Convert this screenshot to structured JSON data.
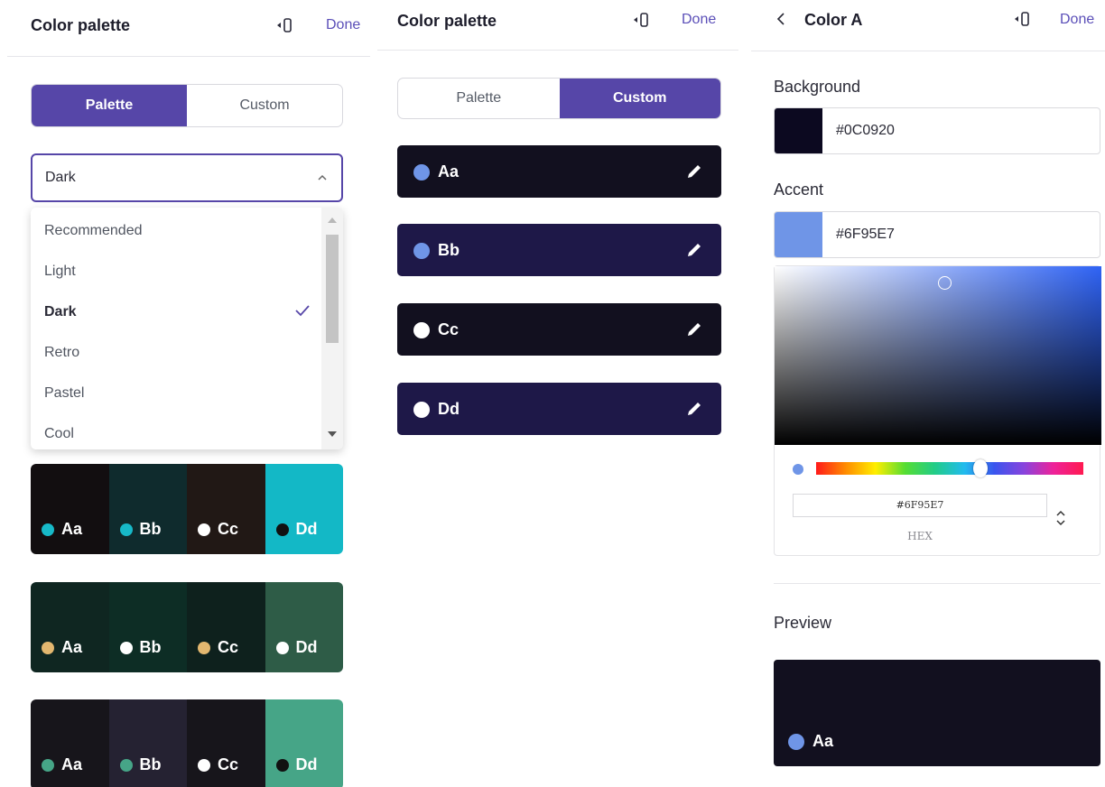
{
  "panel1": {
    "title": "Color palette",
    "icon": "mobile-preview-icon",
    "done": "Done",
    "tabs": [
      "Palette",
      "Custom"
    ],
    "active_tab": "Palette",
    "dropdown_value": "Dark",
    "options": [
      "Recommended",
      "Light",
      "Dark",
      "Retro",
      "Pastel",
      "Cool"
    ],
    "selected_option": "Dark",
    "palettes": [
      [
        {
          "label": "Aa",
          "bg": "#120e10",
          "dot": "#17b9c8"
        },
        {
          "label": "Bb",
          "bg": "#0f2b2d",
          "dot": "#17b9c8"
        },
        {
          "label": "Cc",
          "bg": "#211815",
          "dot": "#ffffff"
        },
        {
          "label": "Dd",
          "bg": "#13b8c6",
          "dot": "#111111"
        }
      ],
      [
        {
          "label": "Aa",
          "bg": "#0f2621",
          "dot": "#e3b76f"
        },
        {
          "label": "Bb",
          "bg": "#0d2d25",
          "dot": "#ffffff"
        },
        {
          "label": "Cc",
          "bg": "#0e211d",
          "dot": "#e3b76f"
        },
        {
          "label": "Dd",
          "bg": "#2e5c47",
          "dot": "#ffffff"
        }
      ],
      [
        {
          "label": "Aa",
          "bg": "#17151b",
          "dot": "#46a587"
        },
        {
          "label": "Bb",
          "bg": "#252232",
          "dot": "#46a587"
        },
        {
          "label": "Cc",
          "bg": "#17151b",
          "dot": "#ffffff"
        },
        {
          "label": "Dd",
          "bg": "#46a587",
          "dot": "#111111"
        }
      ]
    ]
  },
  "panel2": {
    "title": "Color palette",
    "icon": "mobile-preview-icon",
    "done": "Done",
    "tabs": [
      "Palette",
      "Custom"
    ],
    "active_tab": "Custom",
    "colors": [
      {
        "label": "Aa",
        "bg": "#12101f",
        "dot": "#6f95e7"
      },
      {
        "label": "Bb",
        "bg": "#1e1848",
        "dot": "#6f95e7"
      },
      {
        "label": "Cc",
        "bg": "#12101f",
        "dot": "#ffffff"
      },
      {
        "label": "Dd",
        "bg": "#1e1848",
        "dot": "#ffffff"
      }
    ]
  },
  "panel3": {
    "title": "Color A",
    "icon": "mobile-preview-icon",
    "done": "Done",
    "background_label": "Background",
    "background_hex": "#0C0920",
    "background_color": "#0c0920",
    "accent_label": "Accent",
    "accent_hex": "#6F95E7",
    "accent_color": "#6f95e7",
    "picker_hex": "#6F95E7",
    "picker_format": "HEX",
    "preview_label": "Preview",
    "preview_text": "Aa"
  },
  "colors": {
    "accent": "#5646a8",
    "done": "#5b4fb8"
  }
}
